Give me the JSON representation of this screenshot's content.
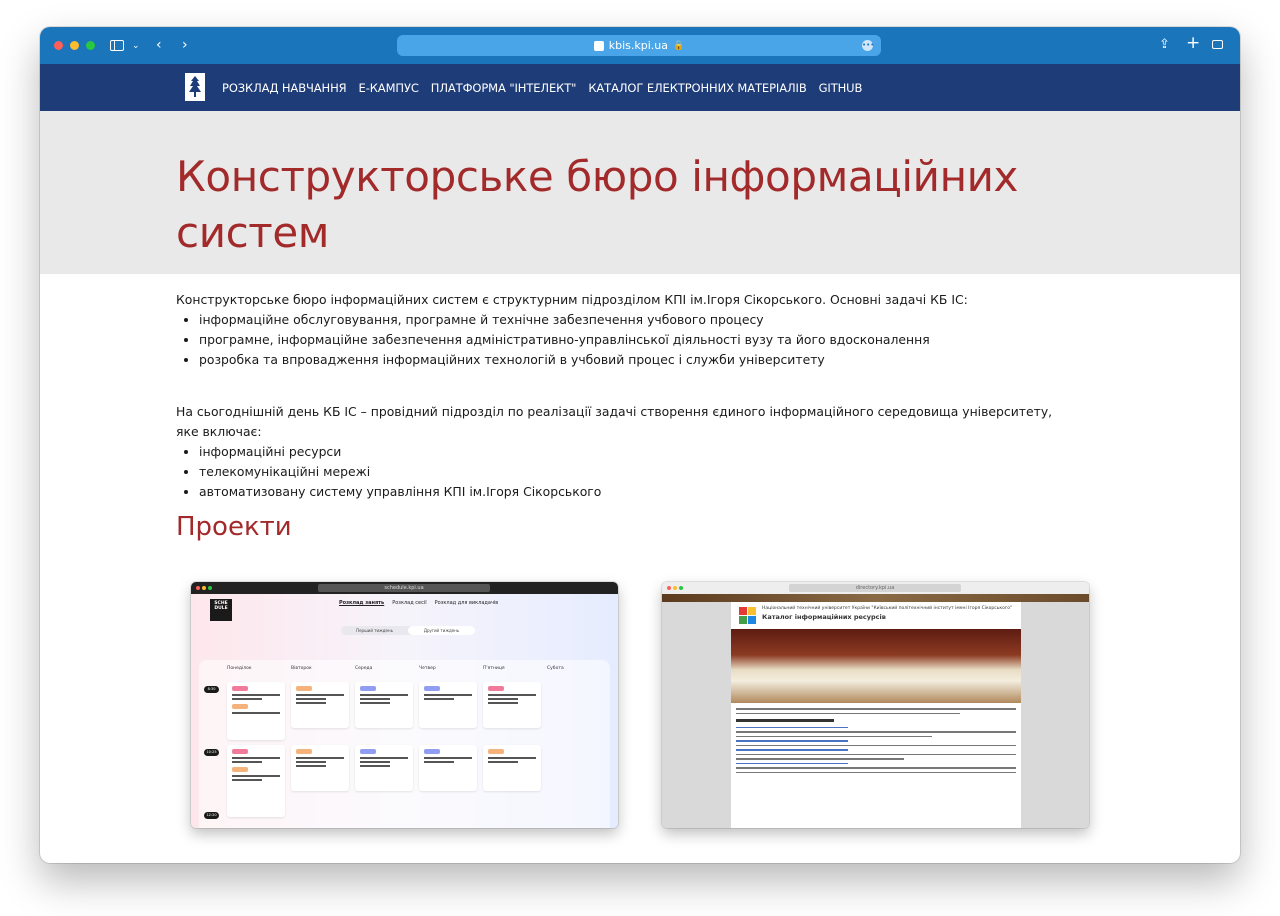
{
  "browser": {
    "url": "kbis.kpi.ua",
    "accent": "#1b75bb"
  },
  "nav": {
    "items": [
      "РОЗКЛАД НАВЧАННЯ",
      "Е-КАМПУС",
      "ПЛАТФОРМА \"ІНТЕЛЕКТ\"",
      "КАТАЛОГ ЕЛЕКТРОННИХ МАТЕРІАЛІВ",
      "GITHUB"
    ],
    "background": "#1d3c78"
  },
  "hero": {
    "title": "Конструкторське бюро інформаційних систем",
    "title_color": "#a32a2a"
  },
  "intro": {
    "text": "Конструкторське бюро інформаційних систем є структурним підрозділом КПІ ім.Ігоря Сікорського. Основні задачі КБ ІС:",
    "items": [
      "інформаційне обслуговування, програмне й технічне забезпечення учбового процесу",
      "програмне, інформаційне забезпечення адміністративно-управлінської діяльності вузу та його вдосконалення",
      "розробка та впровадження інформаційних технологій в учбовий процес і служби університету"
    ]
  },
  "today": {
    "text": "На сьогоднішній день КБ ІС – провідний підрозділ по реалізації задачі створення єдиного інформаційного середовища університету, яке включає:",
    "items": [
      "інформаційні ресурси",
      "телекомунікаційні мережі",
      "автоматизовану систему управління КПІ ім.Ігоря Сікорського"
    ]
  },
  "projects": {
    "title": "Проекти",
    "schedule": {
      "url": "schedule.kpi.ua",
      "logo": "SCHE DULE",
      "tabs": [
        "Розклад занять",
        "Розклад сесії",
        "Розклад для викладачів"
      ],
      "weeks": [
        "Перший тиждень",
        "Другий тиждень"
      ],
      "days": [
        "Понеділок",
        "Вівторок",
        "Середа",
        "Четвер",
        "П'ятниця",
        "Субота"
      ],
      "times": [
        "8:30",
        "10:25",
        "12:20"
      ]
    },
    "catalog": {
      "url": "directory.kpi.ua",
      "org": "Національний технічний університет України \"Київський політехнічний інститут імені Ігоря Сікорського\"",
      "title": "Каталог інформаційних ресурсів"
    }
  }
}
